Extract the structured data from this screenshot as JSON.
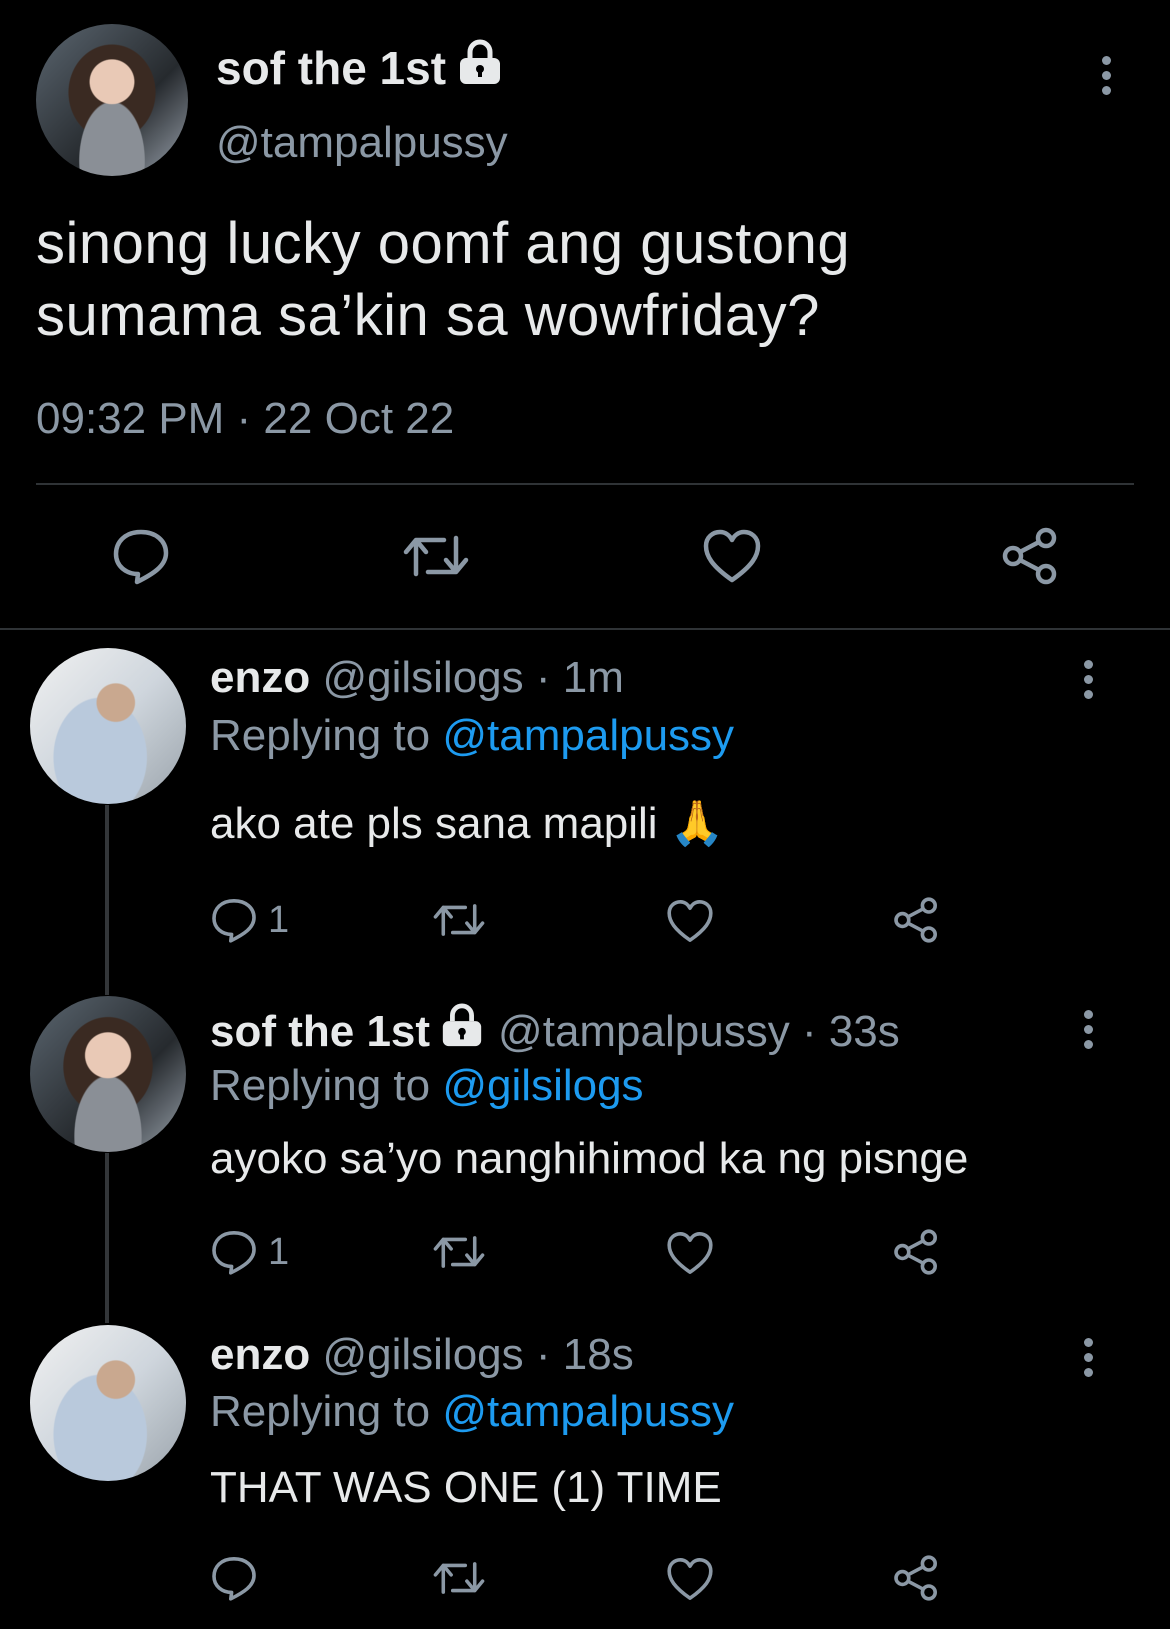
{
  "main_tweet": {
    "display_name": "sof the 1st",
    "handle": "@tampalpussy",
    "text_line1": "sinong lucky oomf ang gustong",
    "text_line2": "sumama sa’kin sa wowfriday?",
    "timestamp": "09:32 PM · 22 Oct 22"
  },
  "replies": [
    {
      "display_name": "enzo",
      "handle_time": "@gilsilogs · 1m",
      "replying_label": "Replying to",
      "replying_to": "@tampalpussy",
      "text": "ako ate pls sana mapili 🙏",
      "reply_count": "1"
    },
    {
      "display_name": "sof the 1st",
      "handle_time": "@tampalpussy · 33s",
      "replying_label": "Replying to",
      "replying_to": "@gilsilogs",
      "text": "ayoko sa’yo nanghihimod ka ng pisnge",
      "reply_count": "1"
    },
    {
      "display_name": "enzo",
      "handle_time": "@gilsilogs · 18s",
      "replying_label": "Replying to",
      "replying_to": "@tampalpussy",
      "text": "THAT WAS ONE (1) TIME",
      "reply_count": ""
    }
  ],
  "colors": {
    "background": "#000000",
    "text": "#e7e9ea",
    "muted": "#8b98a5",
    "link": "#1d9bf0",
    "divider": "#2f3336"
  },
  "icons": [
    "lock-icon",
    "more-icon",
    "reply-icon",
    "retweet-icon",
    "like-icon",
    "share-icon"
  ]
}
